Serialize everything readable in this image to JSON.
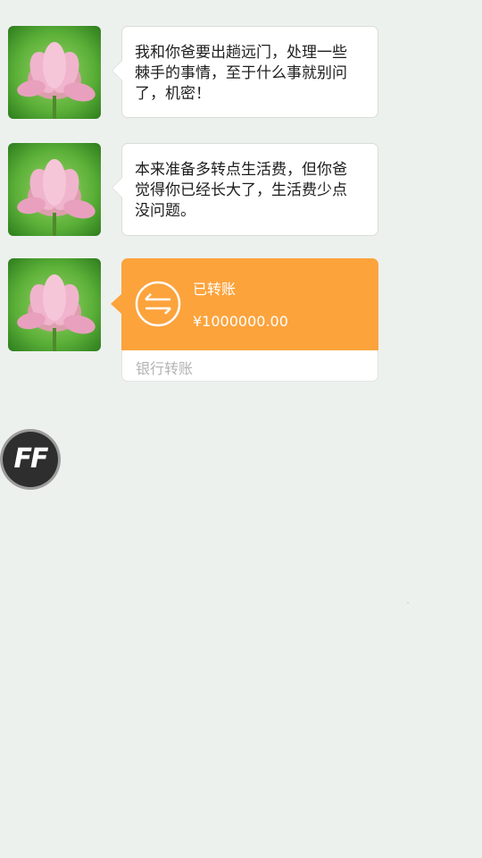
{
  "colors": {
    "background": "#EDF1EE",
    "transfer_orange": "#FCA33C",
    "bubble_white": "#FFFFFF"
  },
  "messages": [
    {
      "avatar": "lotus-flower-avatar",
      "text": "我和你爸要出趟远门，处理一些\n棘手的事情，至于什么事就别问\n了，机密！"
    },
    {
      "avatar": "lotus-flower-avatar",
      "text": "本来准备多转点生活费，但你爸\n觉得你已经长大了，生活费少点\n没问题。"
    }
  ],
  "transfer": {
    "avatar": "lotus-flower-avatar",
    "icon": "transfer-arrows-icon",
    "status": "已转账",
    "amount": "¥1000000.00",
    "type_label": "银行转账"
  },
  "floating_button": {
    "label": "FF"
  }
}
